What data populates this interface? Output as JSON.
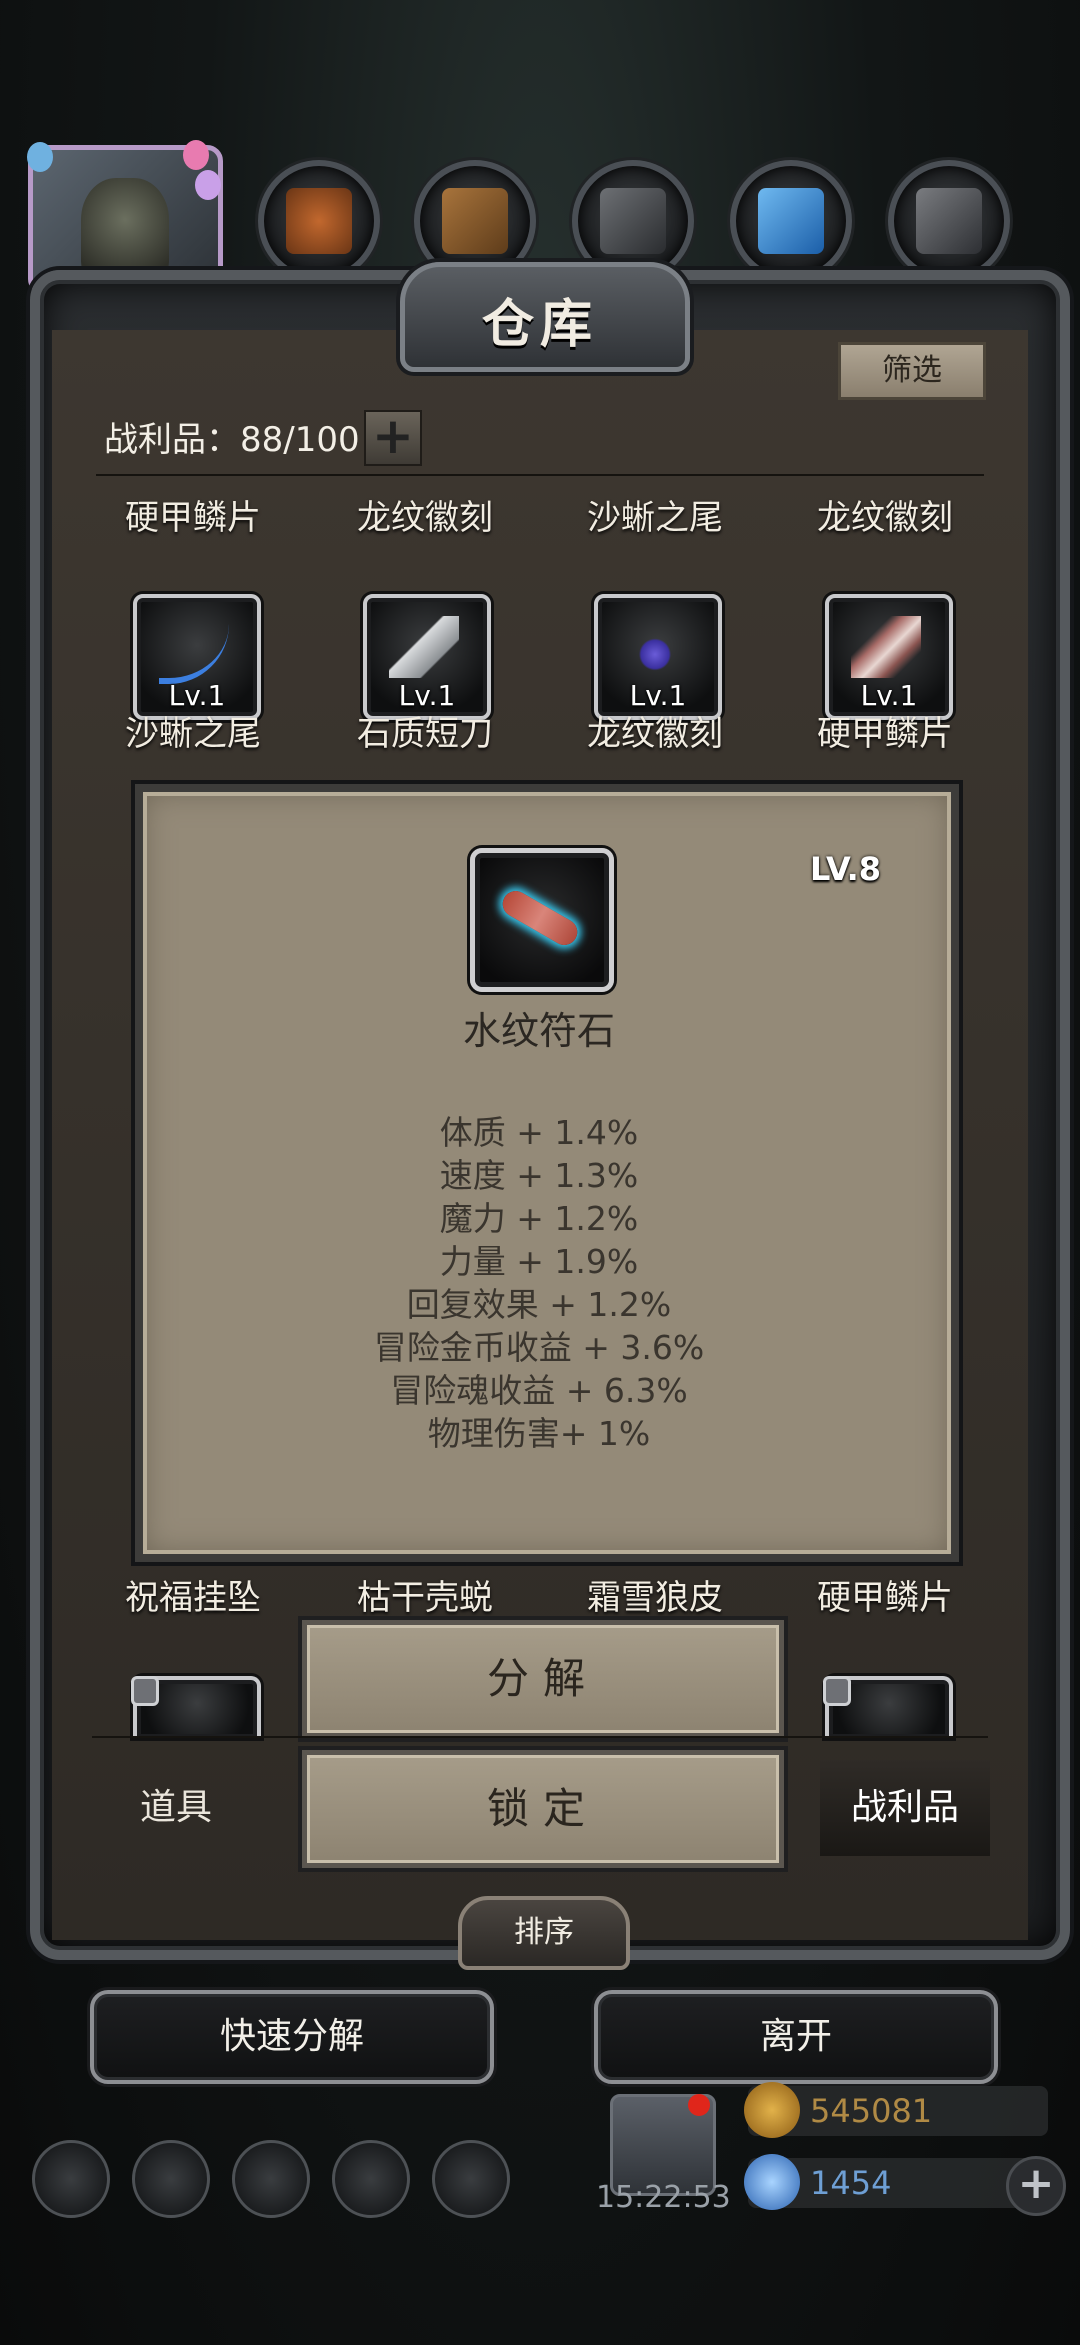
{
  "window": {
    "title": "仓库",
    "filter_label": "筛选"
  },
  "inventory": {
    "count_label": "战利品：88/100",
    "add_icon": "plus-icon"
  },
  "row1_names": [
    "硬甲鳞片",
    "龙纹徽刻",
    "沙蜥之尾",
    "龙纹徽刻"
  ],
  "row2": [
    {
      "level": "Lv.1",
      "name": "沙蜥之尾"
    },
    {
      "level": "Lv.1",
      "name": "石质短刀"
    },
    {
      "level": "Lv.1",
      "name": "龙纹徽刻"
    },
    {
      "level": "Lv.1",
      "name": "硬甲鳞片"
    }
  ],
  "row3_names": [
    "祝福挂坠",
    "枯干壳蜕",
    "霜雪狼皮",
    "硬甲鳞片"
  ],
  "detail": {
    "level": "LV.8",
    "name": "水纹符石",
    "stats": [
      "体质 + 1.4%",
      "速度 + 1.3%",
      "魔力 + 1.2%",
      "力量 + 1.9%",
      "回复效果 + 1.2%",
      "冒险金币收益 + 3.6%",
      "冒险魂收益 + 6.3%",
      "物理伤害+ 1%"
    ]
  },
  "actions": {
    "decompose": "分解",
    "lock": "锁定"
  },
  "tabs": {
    "items": "道具",
    "loot": "战利品"
  },
  "sort_label": "排序",
  "buttons": {
    "quick_decompose": "快速分解",
    "leave": "离开"
  },
  "status": {
    "time": "15:22:53",
    "gold": "545081",
    "gems": "1454"
  },
  "colors": {
    "parchment": "#948a78",
    "gold_text": "#b08a45",
    "gem_text": "#6e9fd4"
  }
}
